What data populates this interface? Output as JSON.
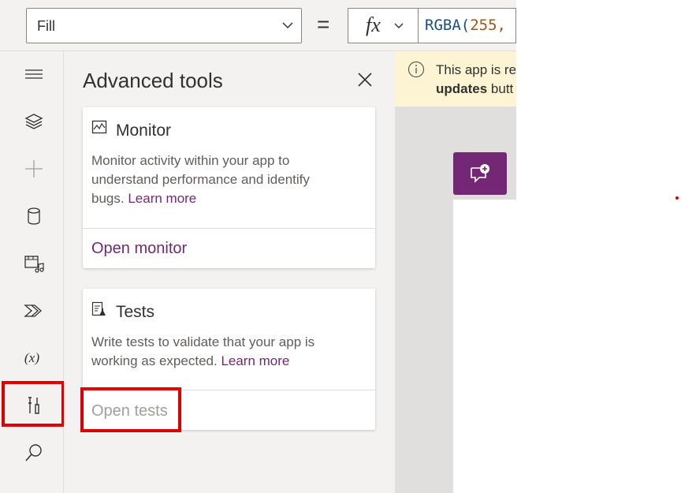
{
  "formula_bar": {
    "property": "Fill",
    "equals": "=",
    "fx": "fx",
    "formula_fn": "RGBA(",
    "formula_num": "255,"
  },
  "rail": {
    "items": [
      "menu-icon",
      "layers-icon",
      "insert-icon",
      "data-icon",
      "media-icon",
      "power-automate-icon",
      "variables-icon",
      "advanced-tools-icon",
      "search-icon"
    ]
  },
  "panel": {
    "title": "Advanced tools",
    "monitor": {
      "title": "Monitor",
      "desc": "Monitor activity within your app to understand performance and identify bugs.",
      "learn_more": "Learn more",
      "action": "Open monitor"
    },
    "tests": {
      "title": "Tests",
      "desc": "Write tests to validate that your app is working as expected.",
      "learn_more": "Learn more",
      "action": "Open tests"
    }
  },
  "banner": {
    "line1": "This app is re",
    "line2_bold": "updates",
    "line2_rest": " butt"
  },
  "colors": {
    "accent": "#742774",
    "highlight": "#e00000",
    "banner_bg": "#fdf4d3"
  }
}
